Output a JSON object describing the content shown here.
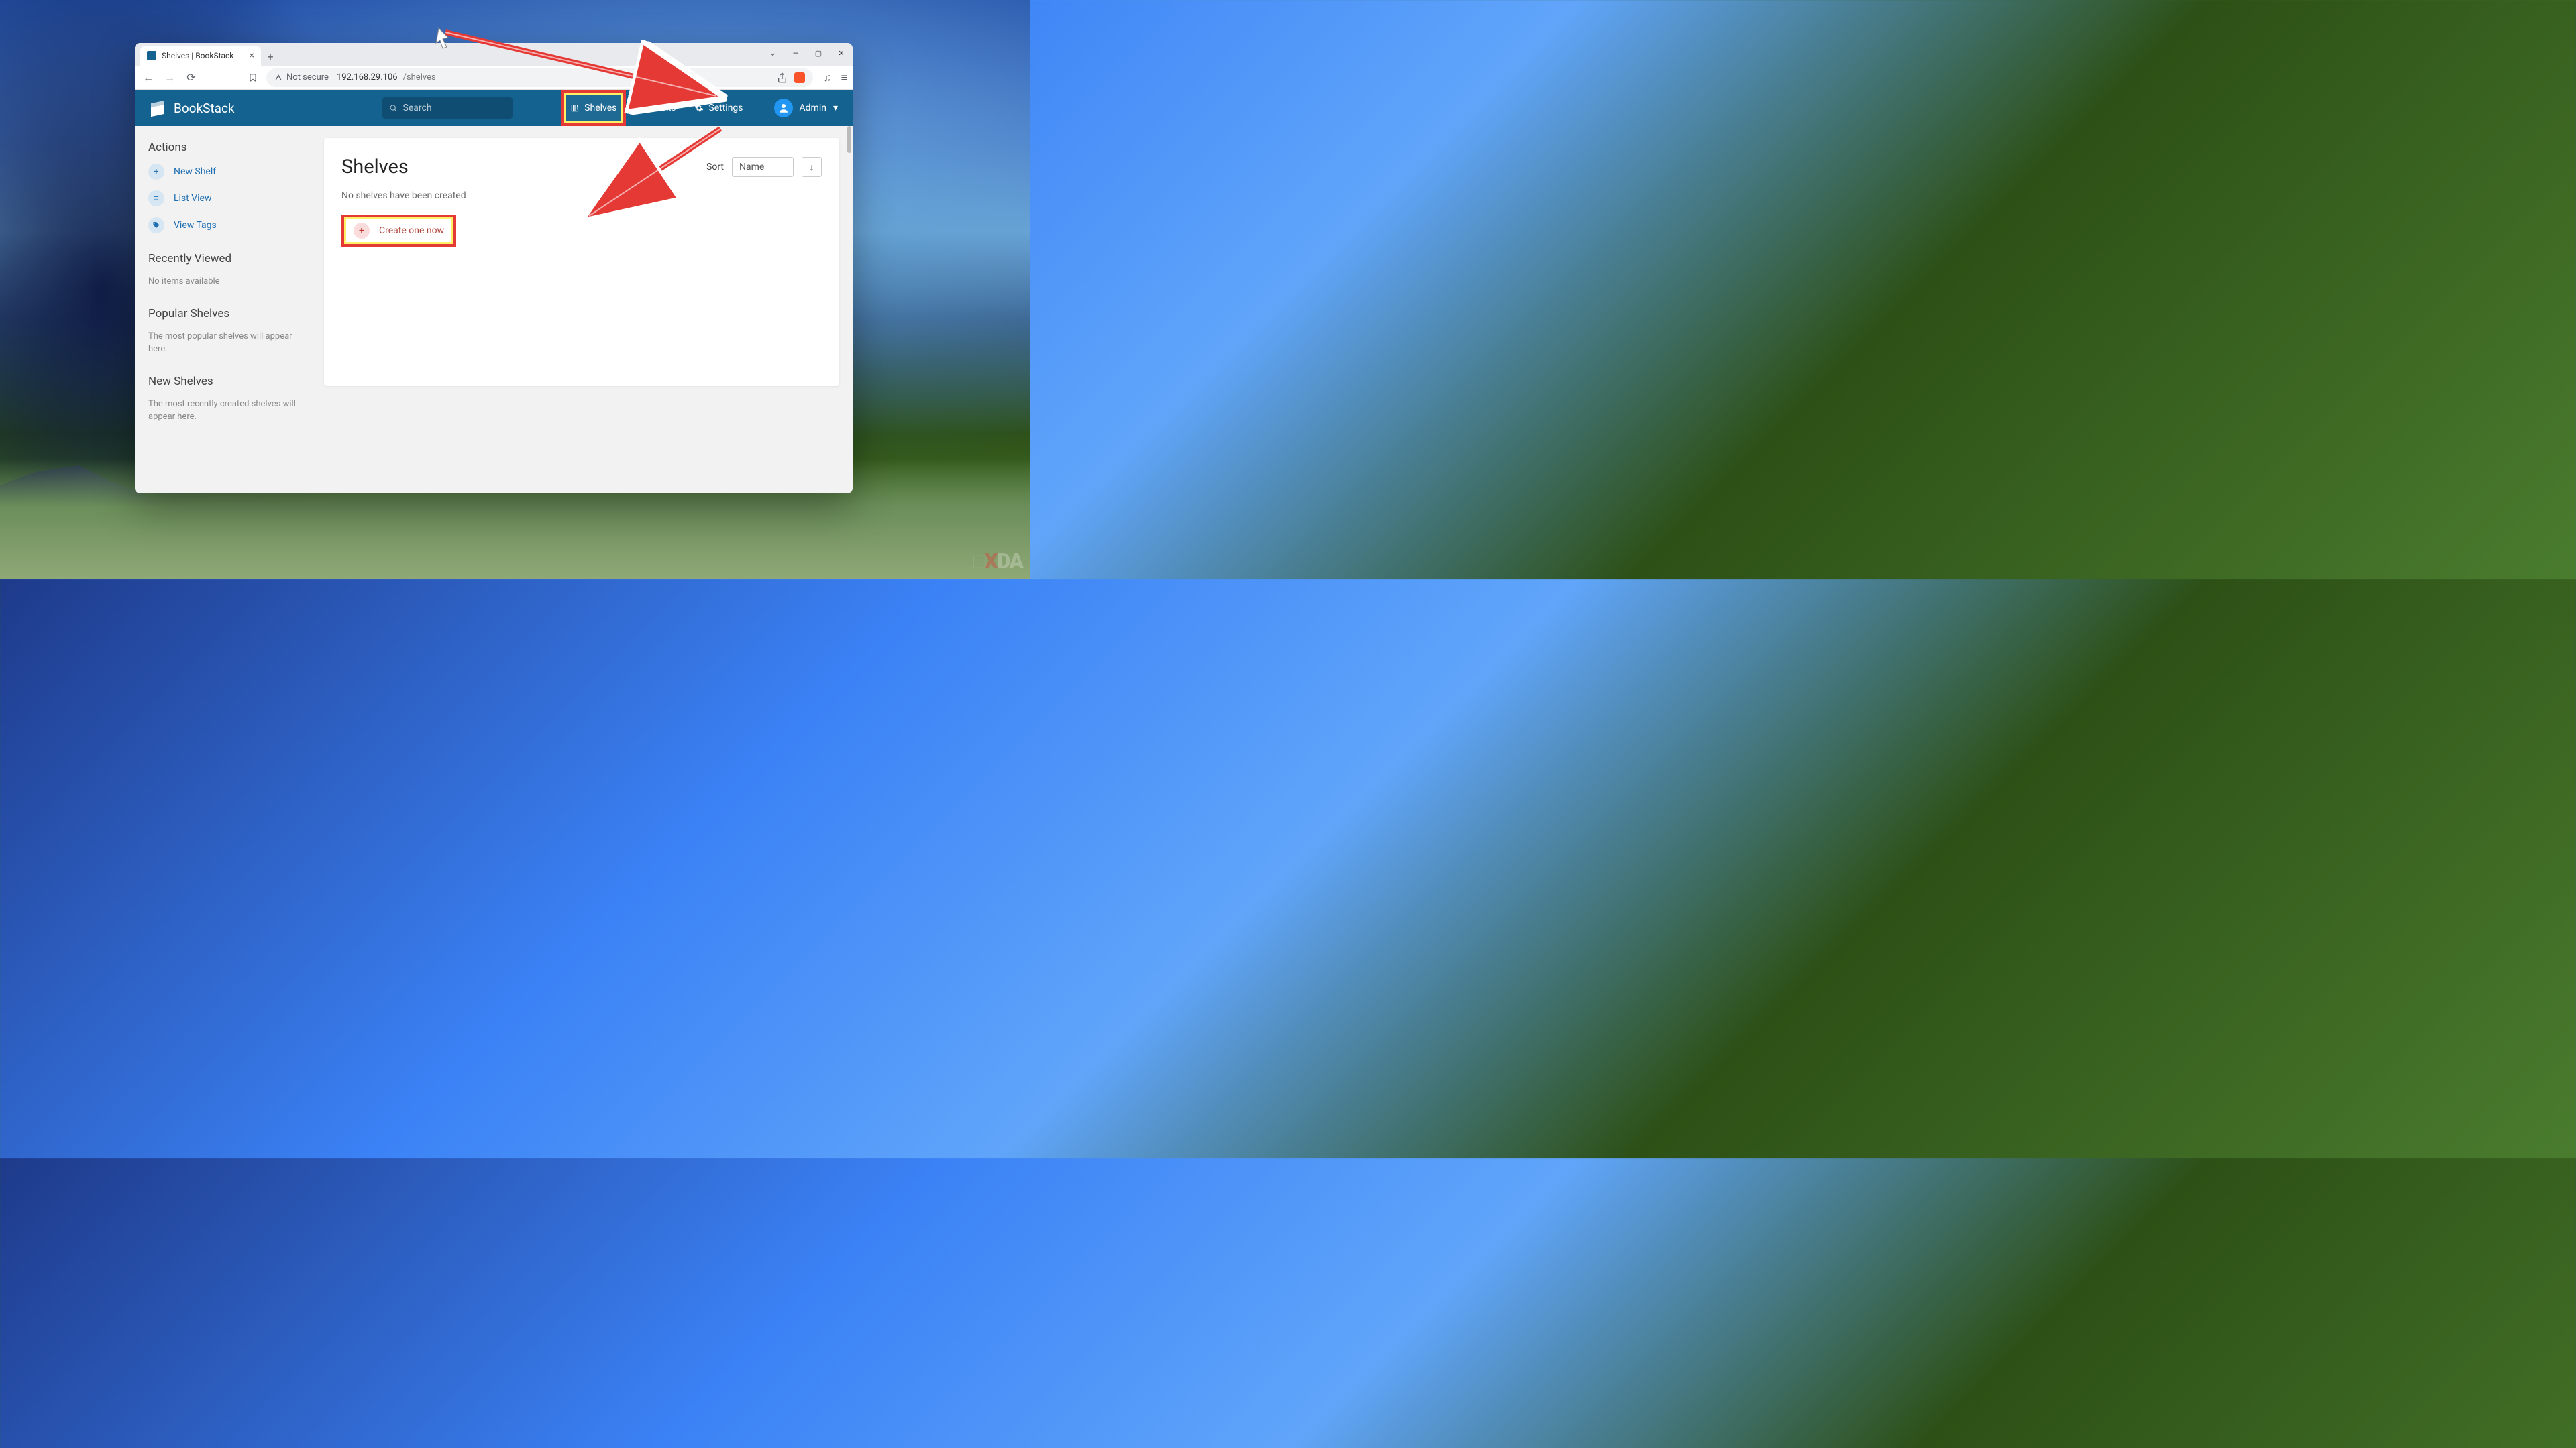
{
  "browser": {
    "tab_title": "Shelves | BookStack",
    "security_label": "Not secure",
    "url_host": "192.168.29.106",
    "url_path": "/shelves"
  },
  "topbar": {
    "app_name": "BookStack",
    "search_placeholder": "Search",
    "nav": {
      "shelves": "Shelves",
      "books": "Books",
      "settings": "Settings"
    },
    "user_name": "Admin"
  },
  "sidebar": {
    "actions_heading": "Actions",
    "actions": {
      "new_shelf": "New Shelf",
      "list_view": "List View",
      "view_tags": "View Tags"
    },
    "recent_heading": "Recently Viewed",
    "recent_empty": "No items available",
    "popular_heading": "Popular Shelves",
    "popular_desc": "The most popular shelves will appear here.",
    "new_heading": "New Shelves",
    "new_desc": "The most recently created shelves will appear here."
  },
  "main": {
    "title": "Shelves",
    "sort_label": "Sort",
    "sort_value": "Name",
    "empty_message": "No shelves have been created",
    "create_label": "Create one now"
  },
  "watermark": "XDA"
}
